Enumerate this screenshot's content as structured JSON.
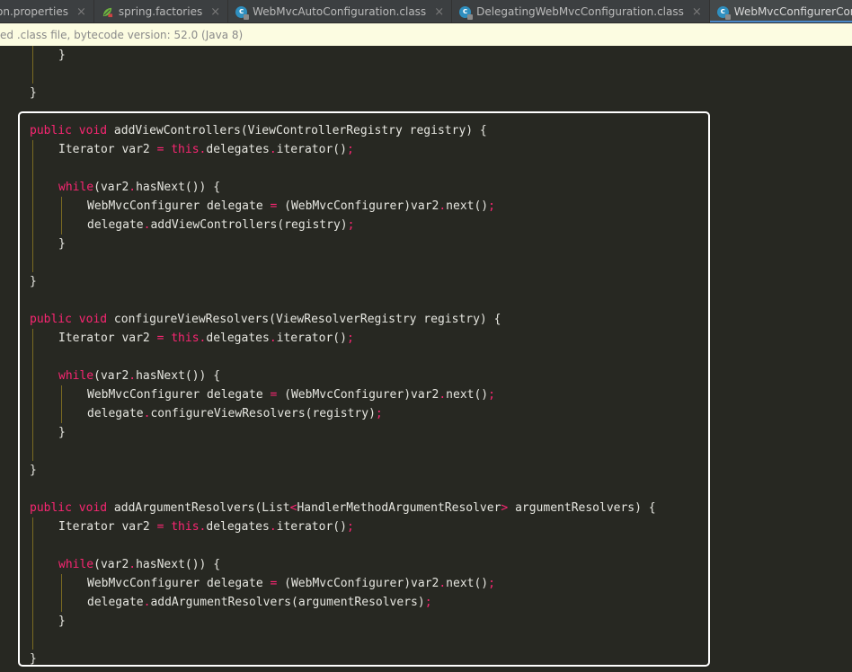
{
  "tabs": [
    {
      "label": "on.properties",
      "icon": "none",
      "active": false
    },
    {
      "label": "spring.factories",
      "icon": "spring-leaf-icon",
      "active": false
    },
    {
      "label": "WebMvcAutoConfiguration.class",
      "icon": "class-file-icon",
      "active": false
    },
    {
      "label": "DelegatingWebMvcConfiguration.class",
      "icon": "class-file-icon",
      "active": false
    },
    {
      "label": "WebMvcConfigurerComposite.class",
      "icon": "class-file-icon",
      "active": true
    }
  ],
  "tab_close_glyph": "×",
  "notice": {
    "text": "ed .class file, bytecode version: 52.0 (Java 8)"
  },
  "colors": {
    "keyword": "#f92672",
    "text": "#e6e6e0",
    "background": "#272822",
    "notice_bg": "#fcfce1",
    "active_tab_underline": "#4a88c7",
    "highlight_border": "#ffffff"
  },
  "code": {
    "lines": [
      {
        "indent": 1,
        "text": "}"
      },
      {
        "indent": 0,
        "text": ""
      },
      {
        "indent": 0,
        "text": "}"
      },
      {
        "indent": 0,
        "text": ""
      },
      {
        "indent": 0,
        "text": "public void addViewControllers(ViewControllerRegistry registry) {"
      },
      {
        "indent": 1,
        "text": "Iterator var2 = this.delegates.iterator();"
      },
      {
        "indent": 0,
        "text": ""
      },
      {
        "indent": 1,
        "text": "while(var2.hasNext()) {"
      },
      {
        "indent": 2,
        "text": "WebMvcConfigurer delegate = (WebMvcConfigurer)var2.next();"
      },
      {
        "indent": 2,
        "text": "delegate.addViewControllers(registry);"
      },
      {
        "indent": 1,
        "text": "}"
      },
      {
        "indent": 0,
        "text": ""
      },
      {
        "indent": 0,
        "text": "}"
      },
      {
        "indent": 0,
        "text": ""
      },
      {
        "indent": 0,
        "text": "public void configureViewResolvers(ViewResolverRegistry registry) {"
      },
      {
        "indent": 1,
        "text": "Iterator var2 = this.delegates.iterator();"
      },
      {
        "indent": 0,
        "text": ""
      },
      {
        "indent": 1,
        "text": "while(var2.hasNext()) {"
      },
      {
        "indent": 2,
        "text": "WebMvcConfigurer delegate = (WebMvcConfigurer)var2.next();"
      },
      {
        "indent": 2,
        "text": "delegate.configureViewResolvers(registry);"
      },
      {
        "indent": 1,
        "text": "}"
      },
      {
        "indent": 0,
        "text": ""
      },
      {
        "indent": 0,
        "text": "}"
      },
      {
        "indent": 0,
        "text": ""
      },
      {
        "indent": 0,
        "text": "public void addArgumentResolvers(List<HandlerMethodArgumentResolver> argumentResolvers) {"
      },
      {
        "indent": 1,
        "text": "Iterator var2 = this.delegates.iterator();"
      },
      {
        "indent": 0,
        "text": ""
      },
      {
        "indent": 1,
        "text": "while(var2.hasNext()) {"
      },
      {
        "indent": 2,
        "text": "WebMvcConfigurer delegate = (WebMvcConfigurer)var2.next();"
      },
      {
        "indent": 2,
        "text": "delegate.addArgumentResolvers(argumentResolvers);"
      },
      {
        "indent": 1,
        "text": "}"
      },
      {
        "indent": 0,
        "text": ""
      },
      {
        "indent": 0,
        "text": "}"
      }
    ]
  }
}
